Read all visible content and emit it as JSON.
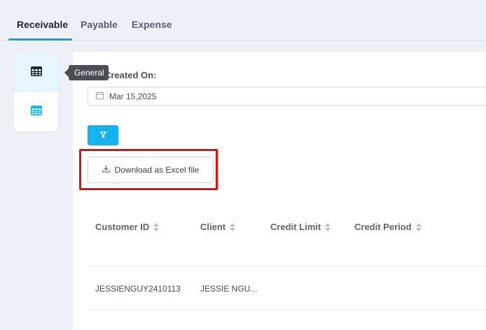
{
  "tabs": [
    {
      "label": "Receivable",
      "active": true
    },
    {
      "label": "Payable",
      "active": false
    },
    {
      "label": "Expense",
      "active": false
    }
  ],
  "side_panel": {
    "items": [
      {
        "icon": "table-grid-icon",
        "color": "#1f2430",
        "active": true
      },
      {
        "icon": "table-grid-icon",
        "color": "#14b3ee",
        "active": false
      }
    ],
    "tooltip": "General"
  },
  "filter": {
    "label": "Created On:",
    "date_value": "Mar 15,2025",
    "button_icon": "filter-icon"
  },
  "download": {
    "label": "Download as Excel file",
    "icon": "download-icon",
    "highlight_color": "#e30d0d"
  },
  "table": {
    "columns": [
      "Customer ID",
      "Client",
      "Credit Limit",
      "Credit Period"
    ],
    "rows": [
      [
        "JESSIENGUY2410113",
        "JESSIE NGU...",
        "",
        ""
      ]
    ]
  },
  "colors": {
    "accent": "#14b3ee",
    "background": "#eef0f7"
  }
}
